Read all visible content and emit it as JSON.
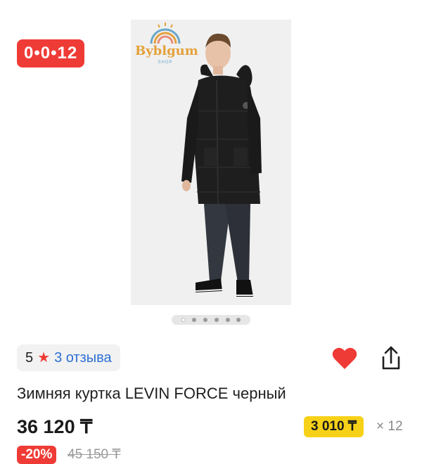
{
  "gallery": {
    "promo_badge": "0•0•12",
    "logo_text": "Byblgum",
    "logo_sub": "SHOP",
    "photo_count": 6,
    "active_photo": 1
  },
  "rating": {
    "score": "5",
    "reviews_label": "3 отзыва"
  },
  "actions": {
    "favorite_icon": "heart-icon",
    "share_icon": "share-icon",
    "favorite_color": "#ef3b36"
  },
  "product": {
    "title": "Зимняя куртка LEVIN FORCE черный",
    "price": "36 120 ₸",
    "installment_price": "3 010 ₸",
    "installment_count": "× 12",
    "discount": "-20%",
    "old_price": "45 150 ₸"
  },
  "colors": {
    "accent_red": "#ef3b36",
    "installment_yellow": "#f7d117",
    "link_blue": "#2c6fd6"
  }
}
